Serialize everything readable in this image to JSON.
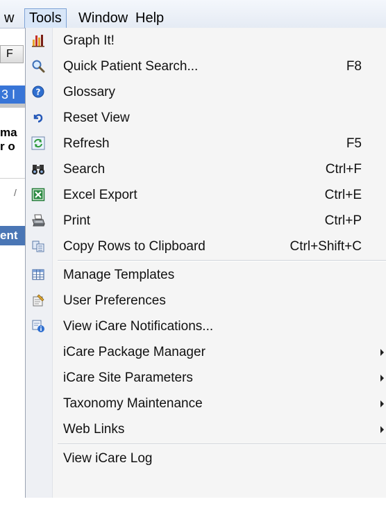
{
  "menubar": {
    "items": [
      {
        "label": "w"
      },
      {
        "label": "Tools"
      },
      {
        "label": "Window"
      },
      {
        "label": "Help"
      }
    ]
  },
  "background_window": {
    "button_label": "F",
    "selected_text": "3 I",
    "bold_lines": [
      "ma",
      "r o"
    ],
    "slash": "/",
    "dark_tab_label": "ent"
  },
  "menu": {
    "items": [
      {
        "label": "Graph It!",
        "shortcut": "",
        "icon": "bar-chart-icon"
      },
      {
        "label": "Quick Patient Search...",
        "shortcut": "F8",
        "icon": "magnifier-icon"
      },
      {
        "label": "Glossary",
        "shortcut": "",
        "icon": "help-icon"
      },
      {
        "label": "Reset View",
        "shortcut": "",
        "icon": "undo-arrow-icon"
      },
      {
        "label": "Refresh",
        "shortcut": "F5",
        "icon": "refresh-icon"
      },
      {
        "label": "Search",
        "shortcut": "Ctrl+F",
        "icon": "binoculars-icon"
      },
      {
        "label": "Excel Export",
        "shortcut": "Ctrl+E",
        "icon": "excel-icon"
      },
      {
        "label": "Print",
        "shortcut": "Ctrl+P",
        "icon": "printer-icon"
      },
      {
        "label": "Copy Rows to Clipboard",
        "shortcut": "Ctrl+Shift+C",
        "icon": "copy-icon"
      },
      {
        "label": "Manage Templates",
        "shortcut": "",
        "icon": "table-icon"
      },
      {
        "label": "User Preferences",
        "shortcut": "",
        "icon": "preferences-icon"
      },
      {
        "label": "View iCare Notifications...",
        "shortcut": "",
        "icon": "notification-icon"
      },
      {
        "label": "iCare Package Manager",
        "shortcut": "",
        "icon": ""
      },
      {
        "label": "iCare Site Parameters",
        "shortcut": "",
        "icon": ""
      },
      {
        "label": "Taxonomy Maintenance",
        "shortcut": "",
        "icon": ""
      },
      {
        "label": "Web Links",
        "shortcut": "",
        "icon": ""
      },
      {
        "label": "View iCare Log",
        "shortcut": "",
        "icon": ""
      }
    ]
  },
  "colors": {
    "menu_bg": "#f5f5f5",
    "active_menu_bg": "#d8e6f8",
    "active_menu_border": "#7fa3d6",
    "selection_blue": "#3875d7"
  }
}
